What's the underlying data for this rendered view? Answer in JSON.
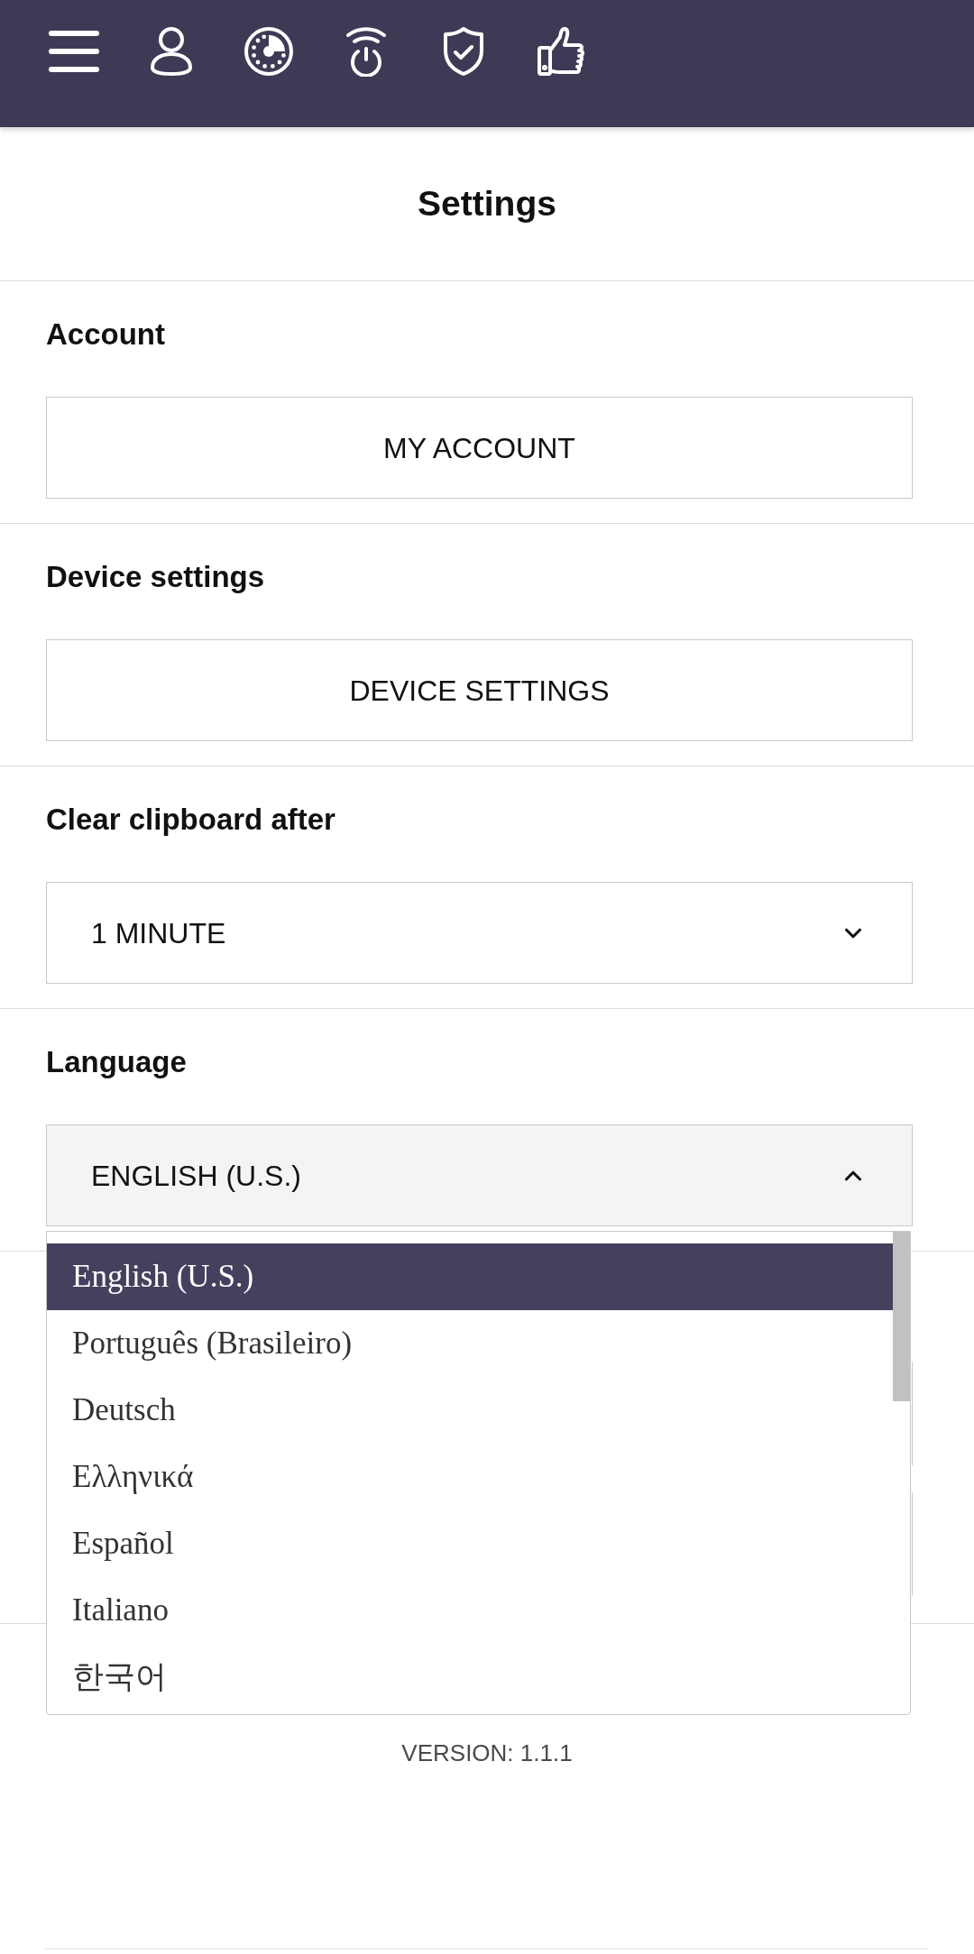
{
  "title": "Settings",
  "sections": [
    {
      "kind": "button",
      "label": "Account",
      "button": "MY ACCOUNT"
    },
    {
      "kind": "button",
      "label": "Device settings",
      "button": "DEVICE SETTINGS"
    },
    {
      "kind": "select",
      "label": "Clear clipboard after",
      "value": "1 MINUTE",
      "expanded": false
    },
    {
      "kind": "select",
      "label": "Language",
      "value": "ENGLISH (U.S.)",
      "expanded": true,
      "options": [
        {
          "label": "English (U.S.)",
          "selected": true
        },
        {
          "label": "Português (Brasileiro)",
          "selected": false
        },
        {
          "label": "Deutsch",
          "selected": false
        },
        {
          "label": "Ελληνικά",
          "selected": false
        },
        {
          "label": "Español",
          "selected": false
        },
        {
          "label": "Italiano",
          "selected": false
        },
        {
          "label": "한국어",
          "selected": false
        }
      ]
    }
  ],
  "version": "VERSION: 1.1.1"
}
